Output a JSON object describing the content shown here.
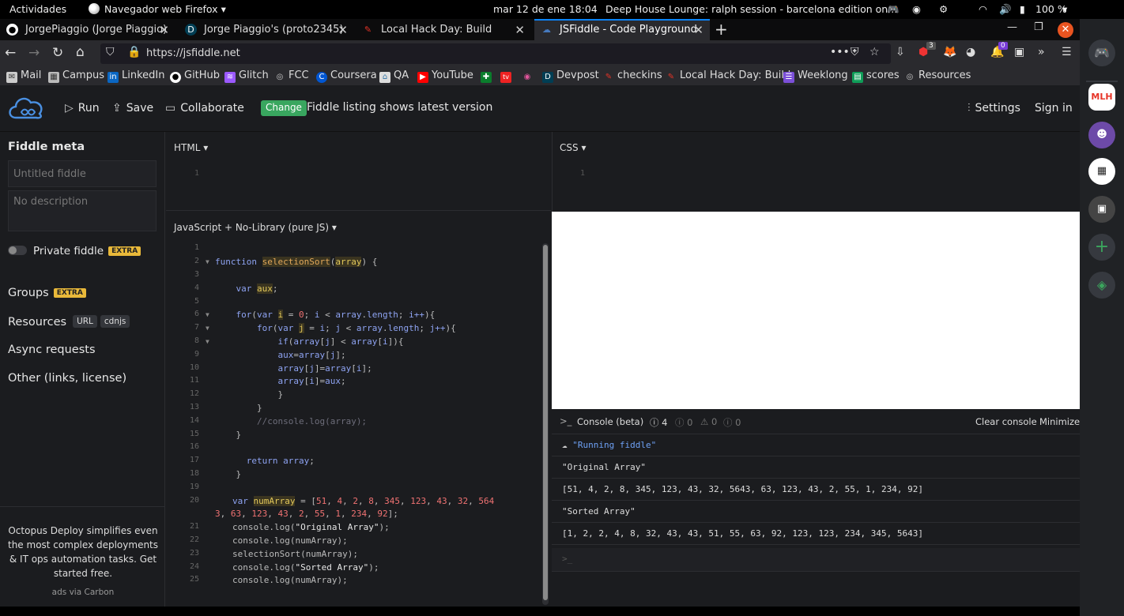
{
  "system_bar": {
    "activities": "Actividades",
    "app": "Navegador web Firefox",
    "clock": "mar 12 de ene  18:04",
    "media": "Deep House Lounge: ralph session - barcelona edition on...",
    "battery": "100 %"
  },
  "tabs": [
    {
      "label": "JorgePiaggio (Jorge Piaggio)",
      "icon": "github-icon"
    },
    {
      "label": "Jorge Piaggio's (proto2345)",
      "icon": "devpost-icon"
    },
    {
      "label": "Local Hack Day: Build",
      "icon": "mlh-icon"
    },
    {
      "label": "JSFiddle - Code Playground",
      "icon": "jsfiddle-icon",
      "active": true
    }
  ],
  "url": "https://jsfiddle.net",
  "badges": {
    "ublock": "3",
    "ext": "0"
  },
  "bookmarks": [
    "Mail",
    "Campus",
    "LinkedIn",
    "GitHub",
    "Glitch",
    "FCC",
    "Coursera",
    "QA",
    "YouTube",
    "",
    "",
    "",
    "Devpost",
    "checkins",
    "Local Hack Day: Build",
    "Weeklong",
    "scores",
    "Resources"
  ],
  "header": {
    "run": "Run",
    "save": "Save",
    "collaborate": "Collaborate",
    "change_badge": "Change",
    "notice": "Fiddle listing shows latest version",
    "settings": "Settings",
    "sign_in": "Sign in"
  },
  "sidebar": {
    "title": "Fiddle meta",
    "title_placeholder": "Untitled fiddle",
    "desc_placeholder": "No description",
    "private": "Private fiddle",
    "extra": "EXTRA",
    "groups": "Groups",
    "resources": "Resources",
    "url_btn": "URL",
    "cdnjs_btn": "cdnjs",
    "async": "Async requests",
    "other": "Other (links, license)",
    "ad_text": "Octopus Deploy simplifies even the most complex deployments & IT ops automation tasks. Get started free.",
    "ad_via": "ads via Carbon"
  },
  "editors": {
    "html_label": "HTML",
    "css_label": "CSS",
    "js_label": "JavaScript + No-Library (pure JS)",
    "line1": "1"
  },
  "js_lines": [
    "1",
    "2",
    "3",
    "4",
    "5",
    "6",
    "7",
    "8",
    "9",
    "10",
    "11",
    "12",
    "13",
    "14",
    "15",
    "16",
    "17",
    "18",
    "19",
    "20",
    "21",
    "22",
    "23",
    "24",
    "25"
  ],
  "console": {
    "title": "Console (beta)",
    "count": "4",
    "c_info": "0",
    "c_warn": "0",
    "c_err": "0",
    "clear": "Clear console",
    "minimize": "Minimize",
    "rows": [
      "\"Running fiddle\"",
      "\"Original Array\"",
      "[51, 4, 2, 8, 345, 123, 43, 32, 5643, 63, 123, 43, 2, 55, 1, 234, 92]",
      "\"Sorted Array\"",
      "[1, 2, 2, 4, 8, 32, 43, 43, 51, 55, 63, 92, 123, 123, 234, 345, 5643]"
    ],
    "prompt": ">_"
  },
  "dock": {
    "mlh": "MLH"
  }
}
